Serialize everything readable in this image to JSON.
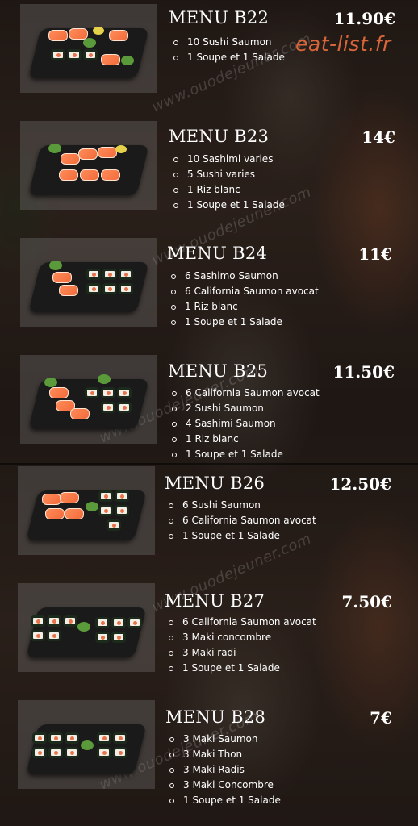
{
  "brand": "eat-list.fr",
  "watermark": "www.ouodejeuner.com",
  "colors": {
    "brand": "#d9663a",
    "text": "#ffffff"
  },
  "menus": [
    {
      "name": "MENU B22",
      "price": "11.90€",
      "items": [
        "10 Sushi Saumon",
        "1 Soupe et 1 Salade"
      ]
    },
    {
      "name": "MENU B23",
      "price": "14€",
      "items": [
        "10 Sashimi varies",
        "5 Sushi varies",
        "1 Riz blanc",
        "1 Soupe et 1 Salade"
      ]
    },
    {
      "name": "MENU B24",
      "price": "11€",
      "items": [
        "6 Sashimo Saumon",
        "6 California Saumon avocat",
        "1 Riz blanc",
        "1 Soupe et 1 Salade"
      ]
    },
    {
      "name": "MENU B25",
      "price": "11.50€",
      "items": [
        "6 California Saumon avocat",
        "2 Sushi Saumon",
        "4 Sashimi Saumon",
        "1 Riz blanc",
        "1 Soupe et 1 Salade"
      ]
    },
    {
      "name": "MENU B26",
      "price": "12.50€",
      "items": [
        "6 Sushi Saumon",
        "6 California Saumon avocat",
        "1 Soupe et 1 Salade"
      ]
    },
    {
      "name": "MENU B27",
      "price": "7.50€",
      "items": [
        "6 California Saumon avocat",
        "3 Maki concombre",
        "3 Maki radi",
        "1 Soupe et 1 Salade"
      ]
    },
    {
      "name": "MENU B28",
      "price": "7€",
      "items": [
        "3 Maki Saumon",
        "3 Maki Thon",
        "3 Maki Radis",
        "3 Maki Concombre",
        "1 Soupe et 1 Salade"
      ]
    }
  ]
}
